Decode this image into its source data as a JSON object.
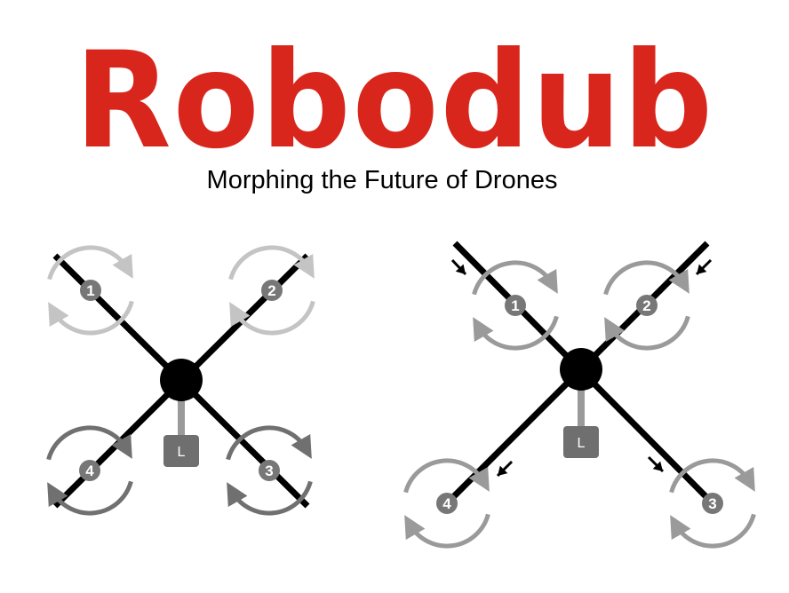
{
  "header": {
    "logo_text": "Robodub",
    "tagline": "Morphing the Future of Drones"
  },
  "colors": {
    "brand_red": "#d9261c",
    "arm": "#000000",
    "hub": "#000000",
    "motor_dot": "#777777",
    "load_box": "#6f6f6f",
    "ring_light": "#c4c4c4",
    "ring_mid": "#9a9a9a",
    "ring_dark": "#707070"
  },
  "drones": [
    {
      "id": "standard",
      "load_label": "L",
      "motors": [
        {
          "label": "1",
          "ring": "light"
        },
        {
          "label": "2",
          "ring": "light"
        },
        {
          "label": "3",
          "ring": "dark"
        },
        {
          "label": "4",
          "ring": "dark"
        }
      ]
    },
    {
      "id": "morphed",
      "load_label": "L",
      "motors": [
        {
          "label": "1",
          "ring": "mid"
        },
        {
          "label": "2",
          "ring": "mid"
        },
        {
          "label": "3",
          "ring": "mid"
        },
        {
          "label": "4",
          "ring": "mid"
        }
      ],
      "arm_shift_arrow_icons": [
        "arrow-in-icon",
        "arrow-in-icon",
        "arrow-out-icon",
        "arrow-out-icon"
      ]
    }
  ]
}
